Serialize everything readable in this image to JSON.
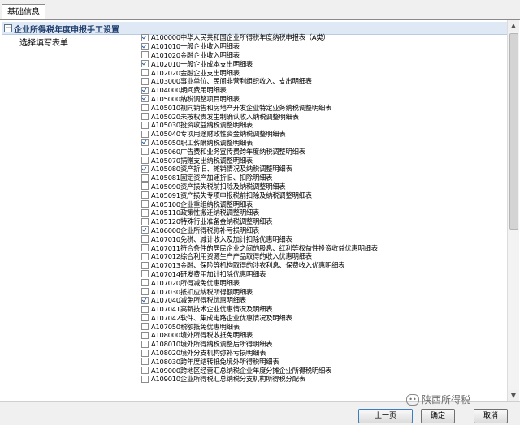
{
  "tab": {
    "label": "基础信息"
  },
  "section": {
    "title": "企业所得税年度申报手工设置",
    "toggle": "−"
  },
  "field_label": "选择填写表单",
  "forms": [
    {
      "code": "A100000",
      "name": "中华人民共和国企业所得税年度纳税申报表（A类）",
      "checked": true
    },
    {
      "code": "A101010",
      "name": "一般企业收入明细表",
      "checked": true
    },
    {
      "code": "A101020",
      "name": "金融企业收入明细表",
      "checked": false
    },
    {
      "code": "A102010",
      "name": "一般企业成本支出明细表",
      "checked": true
    },
    {
      "code": "A102020",
      "name": "金融企业支出明细表",
      "checked": false
    },
    {
      "code": "A103000",
      "name": "事业单位、民间非营利组织收入、支出明细表",
      "checked": false
    },
    {
      "code": "A104000",
      "name": "期间费用明细表",
      "checked": true
    },
    {
      "code": "A105000",
      "name": "纳税调整项目明细表",
      "checked": true
    },
    {
      "code": "A105010",
      "name": "视同销售和房地产开发企业特定业务纳税调整明细表",
      "checked": false
    },
    {
      "code": "A105020",
      "name": "未按权责发生制确认收入纳税调整明细表",
      "checked": false
    },
    {
      "code": "A105030",
      "name": "投资收益纳税调整明细表",
      "checked": false
    },
    {
      "code": "A105040",
      "name": "专项用途财政性资金纳税调整明细表",
      "checked": false
    },
    {
      "code": "A105050",
      "name": "职工薪酬纳税调整明细表",
      "checked": true
    },
    {
      "code": "A105060",
      "name": "广告费和业务宣传费跨年度纳税调整明细表",
      "checked": false
    },
    {
      "code": "A105070",
      "name": "捐赠支出纳税调整明细表",
      "checked": false
    },
    {
      "code": "A105080",
      "name": "资产折旧、摊销情况及纳税调整明细表",
      "checked": true
    },
    {
      "code": "A105081",
      "name": "固定资产加速折旧、扣除明细表",
      "checked": false
    },
    {
      "code": "A105090",
      "name": "资产损失税前扣除及纳税调整明细表",
      "checked": false
    },
    {
      "code": "A105091",
      "name": "资产损失专项申报税前扣除及纳税调整明细表",
      "checked": false
    },
    {
      "code": "A105100",
      "name": "企业重组纳税调整明细表",
      "checked": false
    },
    {
      "code": "A105110",
      "name": "政策性搬迁纳税调整明细表",
      "checked": false
    },
    {
      "code": "A105120",
      "name": "特殊行业准备金纳税调整明细表",
      "checked": false
    },
    {
      "code": "A106000",
      "name": "企业所得税弥补亏损明细表",
      "checked": true
    },
    {
      "code": "A107010",
      "name": "免税、减计收入及加计扣除优惠明细表",
      "checked": false
    },
    {
      "code": "A107011",
      "name": "符合条件的居民企业之间的股息、红利等权益性投资收益优惠明细表",
      "checked": false
    },
    {
      "code": "A107012",
      "name": "综合利用资源生产产品取得的收入优惠明细表",
      "checked": false
    },
    {
      "code": "A107013",
      "name": "金融、保险等机构取得的涉农利息、保费收入优惠明细表",
      "checked": false
    },
    {
      "code": "A107014",
      "name": "研发费用加计扣除优惠明细表",
      "checked": false
    },
    {
      "code": "A107020",
      "name": "所得减免优惠明细表",
      "checked": false
    },
    {
      "code": "A107030",
      "name": "抵扣应纳税所得额明细表",
      "checked": false
    },
    {
      "code": "A107040",
      "name": "减免所得税优惠明细表",
      "checked": true
    },
    {
      "code": "A107041",
      "name": "高新技术企业优惠情况及明细表",
      "checked": false
    },
    {
      "code": "A107042",
      "name": "软件、集成电路企业优惠情况及明细表",
      "checked": false
    },
    {
      "code": "A107050",
      "name": "税额抵免优惠明细表",
      "checked": false
    },
    {
      "code": "A108000",
      "name": "境外所得税收抵免明细表",
      "checked": false
    },
    {
      "code": "A108010",
      "name": "境外所得纳税调整后所得明细表",
      "checked": false
    },
    {
      "code": "A108020",
      "name": "境外分支机构弥补亏损明细表",
      "checked": false
    },
    {
      "code": "A108030",
      "name": "跨年度结转抵免境外所得税明细表",
      "checked": false
    },
    {
      "code": "A109000",
      "name": "跨地区经营汇总纳税企业年度分摊企业所得税明细表",
      "checked": false
    },
    {
      "code": "A109010",
      "name": "企业所得税汇总纳税分支机构所得税分配表",
      "checked": false
    }
  ],
  "buttons": {
    "prev": "上一页",
    "ok": "确定",
    "cancel": "取消"
  },
  "watermark": {
    "text": "陕西所得税"
  },
  "colors": {
    "section_bg": "#dfe9f5",
    "check": "#2c5fa8",
    "primary_border": "#3b7bbf"
  }
}
